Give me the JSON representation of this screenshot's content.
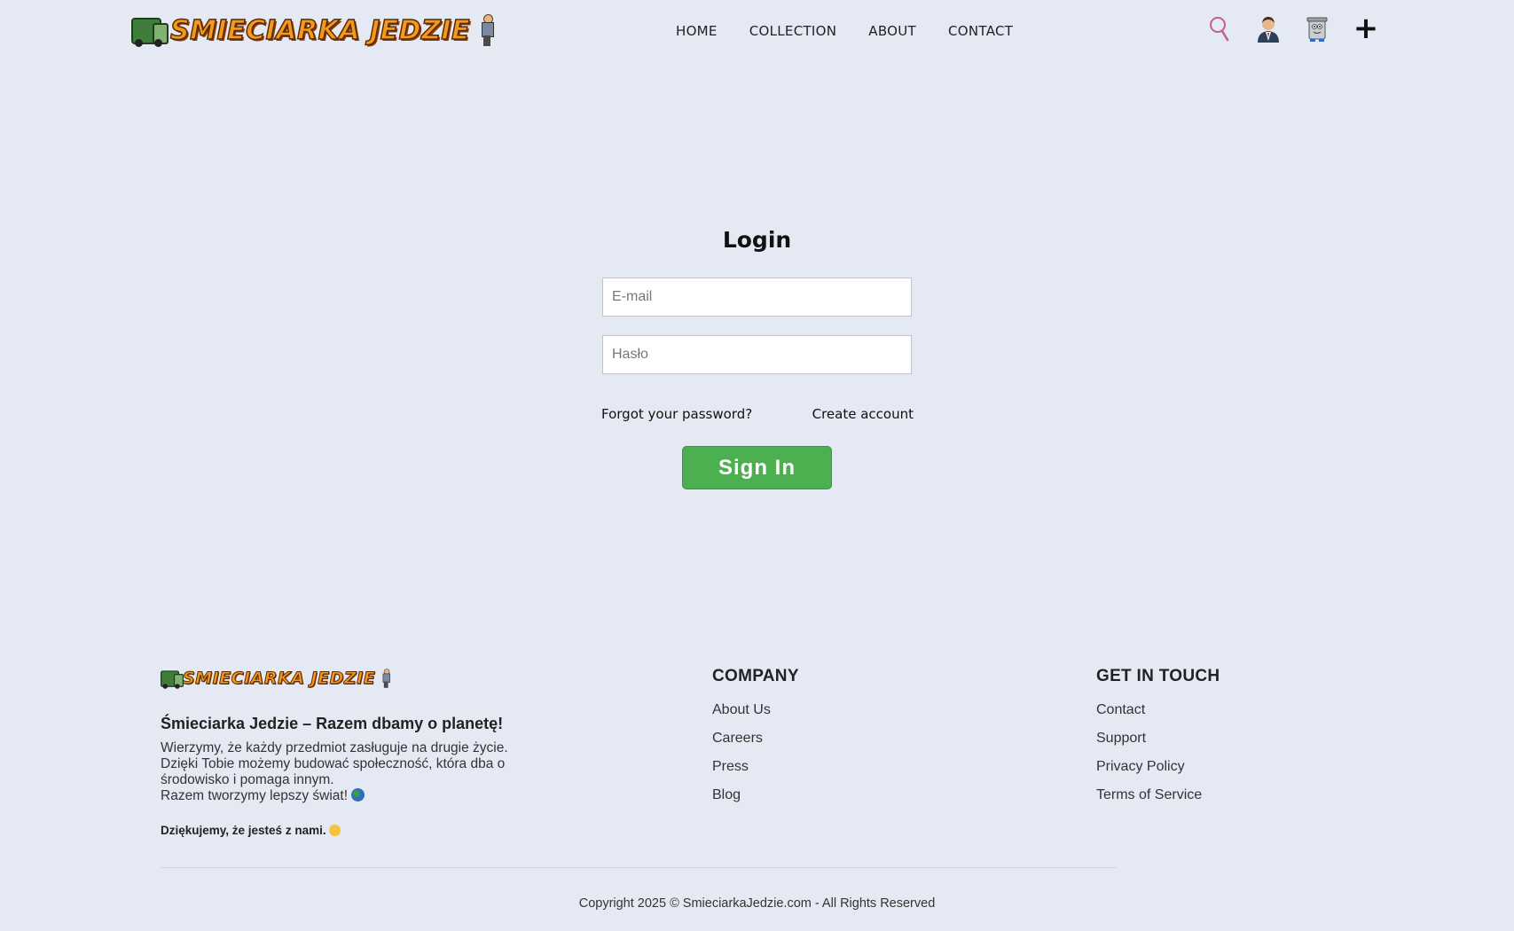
{
  "header": {
    "logo_text": "SMIECIARKA JEDZIE",
    "nav": [
      {
        "label": "HOME"
      },
      {
        "label": "COLLECTION"
      },
      {
        "label": "ABOUT"
      },
      {
        "label": "CONTACT"
      }
    ],
    "icons": [
      "search-icon",
      "user-icon",
      "trash-bin-icon",
      "plus-icon"
    ]
  },
  "login": {
    "title": "Login",
    "email_placeholder": "E-mail",
    "password_placeholder": "Hasło",
    "forgot_label": "Forgot your password?",
    "create_label": "Create account",
    "signin_label": "Sign In",
    "signin_color": "#4caf50"
  },
  "footer": {
    "logo_text": "SMIECIARKA JEDZIE",
    "heading": "Śmieciarka Jedzie – Razem dbamy o planetę!",
    "desc_1": "Wierzymy, że każdy przedmiot zasługuje na drugie życie. Dzięki Tobie możemy budować społeczność, która dba o środowisko i pomaga innym.",
    "desc_2": "Razem tworzymy lepszy świat!",
    "thanks": "Dziękujemy, że jesteś z nami.",
    "company": {
      "title": "COMPANY",
      "links": [
        "About Us",
        "Careers",
        "Press",
        "Blog"
      ]
    },
    "touch": {
      "title": "GET IN TOUCH",
      "links": [
        "Contact",
        "Support",
        "Privacy Policy",
        "Terms of Service"
      ]
    },
    "copyright": "Copyright 2025 © SmieciarkaJedzie.com - All Rights Reserved"
  }
}
